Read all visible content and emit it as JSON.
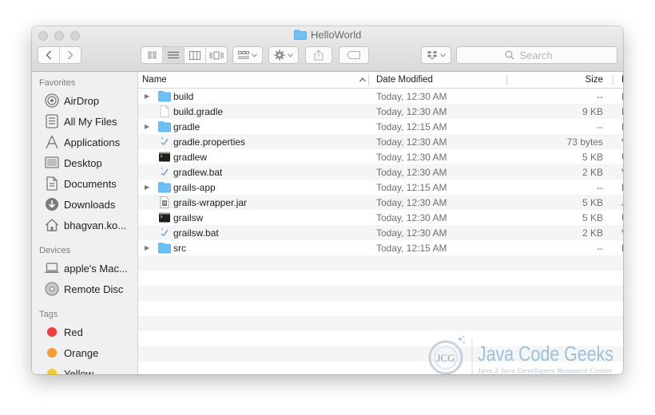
{
  "window": {
    "title": "HelloWorld"
  },
  "toolbar": {
    "view_modes": [
      "icon-view",
      "list-view",
      "column-view",
      "cover-flow-view"
    ],
    "active_view": "list-view",
    "search_placeholder": "Search"
  },
  "sidebar": {
    "favorites_heading": "Favorites",
    "favorites": [
      {
        "label": "AirDrop",
        "icon": "airdrop-icon"
      },
      {
        "label": "All My Files",
        "icon": "all-files-icon"
      },
      {
        "label": "Applications",
        "icon": "applications-icon"
      },
      {
        "label": "Desktop",
        "icon": "desktop-icon"
      },
      {
        "label": "Documents",
        "icon": "documents-icon"
      },
      {
        "label": "Downloads",
        "icon": "downloads-icon"
      },
      {
        "label": "bhagvan.ko...",
        "icon": "home-icon"
      }
    ],
    "devices_heading": "Devices",
    "devices": [
      {
        "label": "apple's Mac...",
        "icon": "laptop-icon"
      },
      {
        "label": "Remote Disc",
        "icon": "disc-icon"
      }
    ],
    "tags_heading": "Tags",
    "tags": [
      {
        "label": "Red",
        "color": "#f23d3d"
      },
      {
        "label": "Orange",
        "color": "#f79a33"
      },
      {
        "label": "Yellow",
        "color": "#f5cc2e"
      }
    ]
  },
  "columns": {
    "name": "Name",
    "date": "Date Modified",
    "size": "Size",
    "kind": "Kind"
  },
  "files": [
    {
      "name": "build",
      "date": "Today, 12:30 AM",
      "size": "--",
      "kind": "Folder",
      "type": "folder"
    },
    {
      "name": "build.gradle",
      "date": "Today, 12:30 AM",
      "size": "9 KB",
      "kind": "Docume",
      "type": "doc"
    },
    {
      "name": "gradle",
      "date": "Today, 12:15 AM",
      "size": "--",
      "kind": "Folder",
      "type": "folder"
    },
    {
      "name": "gradle.properties",
      "date": "Today, 12:30 AM",
      "size": "73 bytes",
      "kind": "Visual...",
      "type": "vs"
    },
    {
      "name": "gradlew",
      "date": "Today, 12:30 AM",
      "size": "5 KB",
      "kind": "Unix e...",
      "type": "exec"
    },
    {
      "name": "gradlew.bat",
      "date": "Today, 12:30 AM",
      "size": "2 KB",
      "kind": "Visual...",
      "type": "vs"
    },
    {
      "name": "grails-app",
      "date": "Today, 12:15 AM",
      "size": "--",
      "kind": "Folder",
      "type": "folder"
    },
    {
      "name": "grails-wrapper.jar",
      "date": "Today, 12:30 AM",
      "size": "5 KB",
      "kind": "Java JA",
      "type": "jar"
    },
    {
      "name": "grailsw",
      "date": "Today, 12:30 AM",
      "size": "5 KB",
      "kind": "Unix e...",
      "type": "exec"
    },
    {
      "name": "grailsw.bat",
      "date": "Today, 12:30 AM",
      "size": "2 KB",
      "kind": "Visual...",
      "type": "vs"
    },
    {
      "name": "src",
      "date": "Today, 12:15 AM",
      "size": "--",
      "kind": "Folder",
      "type": "folder"
    }
  ],
  "watermark": {
    "logo_text": "JCG",
    "brand": "Java Code Geeks",
    "tagline": "Java 2 Java Developers Resource Center"
  }
}
